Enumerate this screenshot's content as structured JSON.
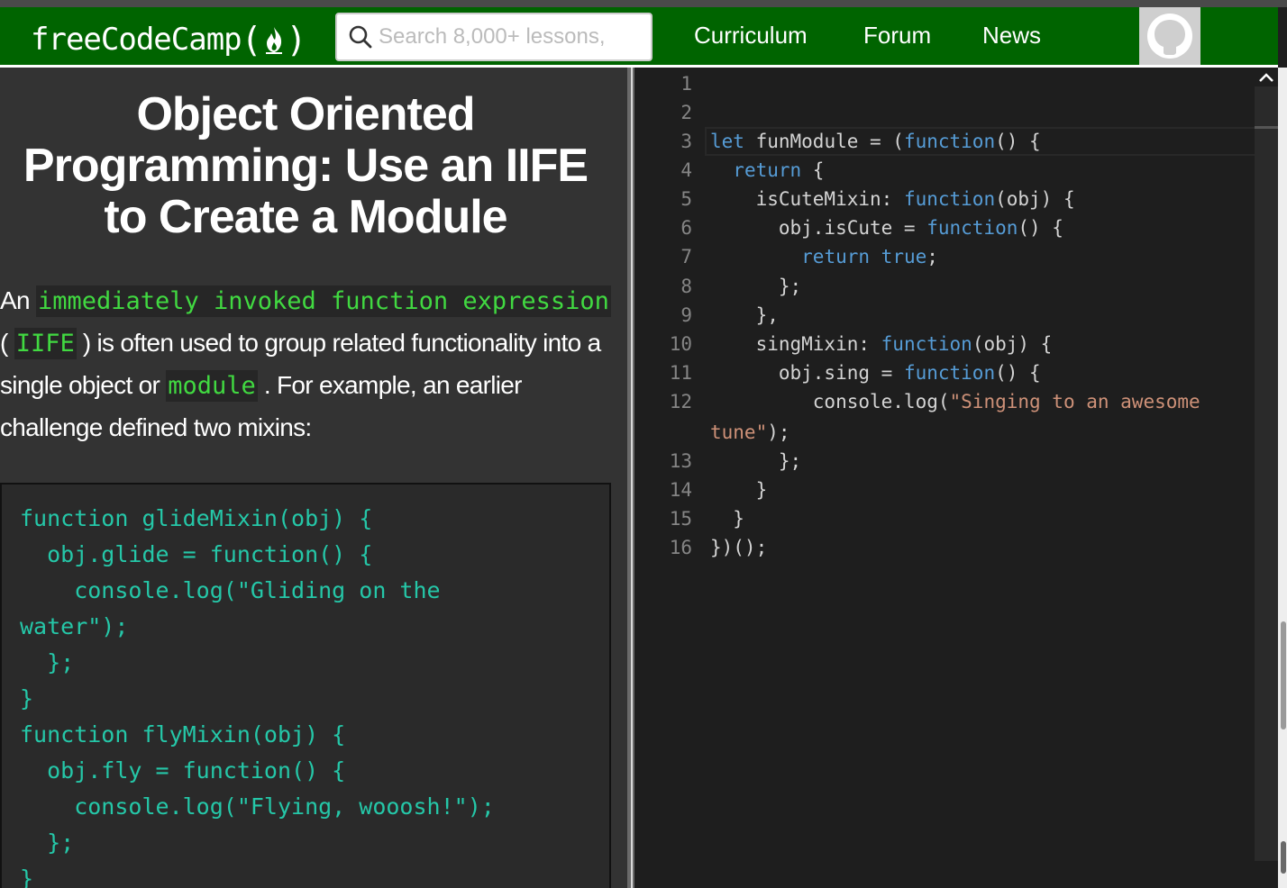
{
  "header": {
    "brand_text": "freeCodeCamp",
    "brand_open": "(",
    "brand_close": ")",
    "search_placeholder": "Search 8,000+ lessons,",
    "nav": [
      {
        "label": "Curriculum"
      },
      {
        "label": "Forum"
      },
      {
        "label": "News"
      }
    ],
    "brand_color": "#006400"
  },
  "lesson": {
    "title": "Object Oriented Programming: Use an IIFE to Create a Module",
    "desc": {
      "p1": "An ",
      "c1": "immediately invoked function expression",
      "p2": " ( ",
      "c2": "IIFE",
      "p3": " ) is often used to group related functionality into a single object or ",
      "c3": "module",
      "p4": " . For example, an earlier challenge defined two mixins:"
    },
    "example_code": "function glideMixin(obj) {\n  obj.glide = function() {\n    console.log(\"Gliding on the\nwater\");\n  };\n}\nfunction flyMixin(obj) {\n  obj.fly = function() {\n    console.log(\"Flying, wooosh!\");\n  };\n}"
  },
  "editor": {
    "lines": [
      {
        "n": "1",
        "t": ""
      },
      {
        "n": "2",
        "t": ""
      },
      {
        "n": "3",
        "t": "let funModule = (function() {"
      },
      {
        "n": "4",
        "t": "  return {"
      },
      {
        "n": "5",
        "t": "    isCuteMixin: function(obj) {"
      },
      {
        "n": "6",
        "t": "      obj.isCute = function() {"
      },
      {
        "n": "7",
        "t": "        return true;"
      },
      {
        "n": "8",
        "t": "      };"
      },
      {
        "n": "9",
        "t": "    },"
      },
      {
        "n": "10",
        "t": "    singMixin: function(obj) {"
      },
      {
        "n": "11",
        "t": "      obj.sing = function() {"
      },
      {
        "n": "12",
        "t": "         console.log(\"Singing to an awesome"
      },
      {
        "n": "",
        "t": "tune\");"
      },
      {
        "n": "13",
        "t": "      };"
      },
      {
        "n": "14",
        "t": "    }"
      },
      {
        "n": "15",
        "t": "  }"
      },
      {
        "n": "16",
        "t": "})();"
      }
    ]
  }
}
